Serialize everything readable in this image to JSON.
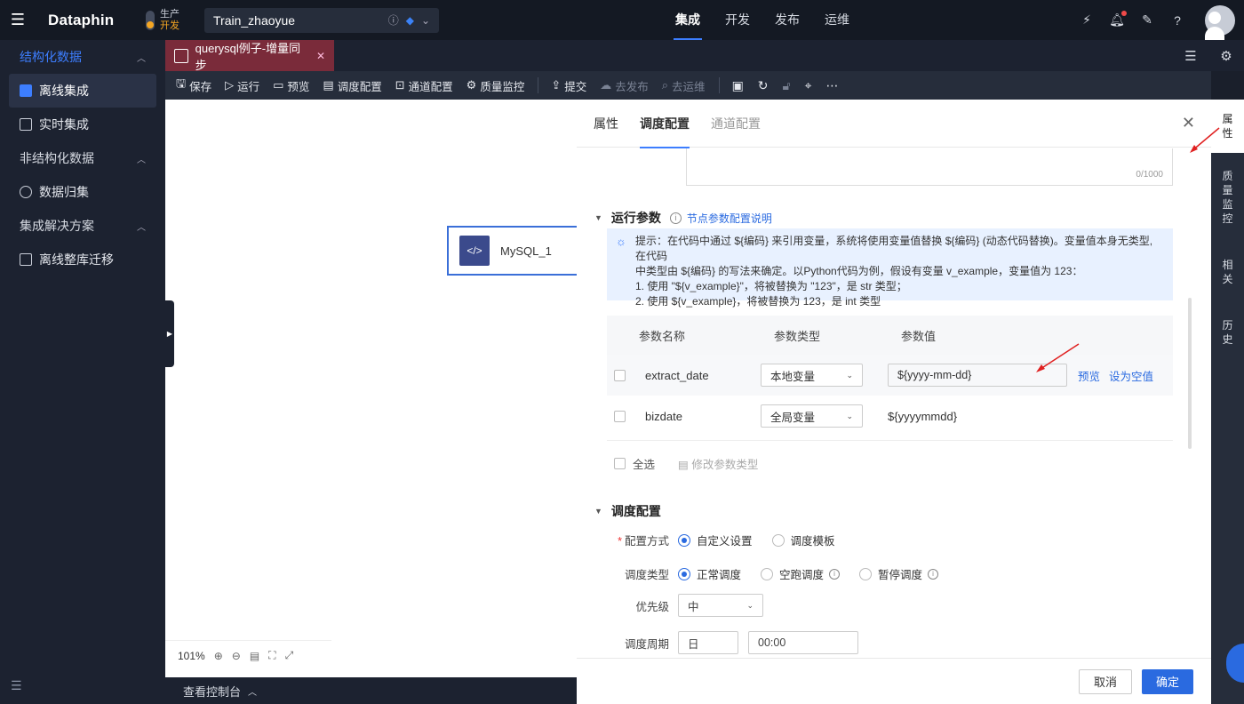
{
  "app": {
    "logo": "Dataphin",
    "env_prod": "生产",
    "env_dev": "开发",
    "project": "Train_zhaoyue"
  },
  "topnav": [
    "集成",
    "开发",
    "发布",
    "运维"
  ],
  "topnav_active": "集成",
  "sidebar": {
    "groups": [
      {
        "label": "结构化数据",
        "items": [
          "离线集成",
          "实时集成"
        ]
      },
      {
        "label": "非结构化数据",
        "items": [
          "数据归集"
        ]
      },
      {
        "label": "集成解决方案",
        "items": [
          "离线整库迁移"
        ]
      }
    ],
    "active_item": "离线集成"
  },
  "tab": {
    "label": "querysql例子-增量同步"
  },
  "toolbar": {
    "save": "保存",
    "run": "运行",
    "preview": "预览",
    "schedule": "调度配置",
    "channel": "通道配置",
    "quality": "质量监控",
    "submit": "提交",
    "publish": "去发布",
    "ops": "去运维"
  },
  "canvas": {
    "node_label": "MySQL_1",
    "zoom": "101%",
    "console": "查看控制台"
  },
  "panel": {
    "tabs": [
      "属性",
      "调度配置",
      "通道配置"
    ],
    "textarea_count": "0/1000",
    "runtime": {
      "title": "运行参数",
      "help_link": "节点参数配置说明",
      "hint_lines": [
        "提示：在代码中通过 ${编码} 来引用变量，系统将使用变量值替换 ${编码} (动态代码替换)。变量值本身无类型, 在代码",
        "中类型由 ${编码} 的写法来确定。以Python代码为例，假设有变量 v_example，变量值为 123：",
        "1. 使用 \"${v_example}\"，将被替换为 \"123\"，是 str 类型；",
        "2. 使用 ${v_example}，将被替换为 123，是 int 类型"
      ],
      "columns": [
        "参数名称",
        "参数类型",
        "参数值"
      ],
      "rows": [
        {
          "name": "extract_date",
          "type": "本地变量",
          "value": "${yyyy-mm-dd}"
        },
        {
          "name": "bizdate",
          "type": "全局变量",
          "value": "${yyyymmdd}"
        }
      ],
      "row_links": [
        "预览",
        "设为空值"
      ],
      "select_all": "全选",
      "modify_type": "修改参数类型"
    },
    "schedule": {
      "title": "调度配置",
      "mode_label": "配置方式",
      "mode_options": [
        "自定义设置",
        "调度模板"
      ],
      "type_label": "调度类型",
      "type_options": [
        "正常调度",
        "空跑调度",
        "暂停调度"
      ],
      "priority_label": "优先级",
      "priority_value": "中",
      "cycle_label": "调度周期",
      "cycle_value": "日",
      "time_value": "00:00"
    },
    "cancel": "取消",
    "confirm": "确定"
  },
  "rail": [
    {
      "label": "属性",
      "chars": [
        "属",
        "性"
      ]
    },
    {
      "label": "质量监控",
      "chars": [
        "质",
        "量",
        "监",
        "控"
      ]
    },
    {
      "label": "相关",
      "chars": [
        "相",
        "关"
      ]
    },
    {
      "label": "历史",
      "chars": [
        "历",
        "史"
      ]
    }
  ],
  "colors": {
    "accent": "#2a6ae0",
    "tab_bg": "#7a2b3a",
    "dev_env": "#f5a623",
    "annotation_arrow": "#e02020"
  }
}
